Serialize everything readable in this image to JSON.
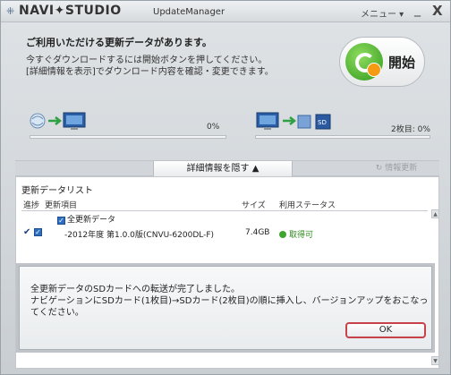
{
  "window": {
    "app_name": "NAVI✦STUDIO",
    "app_sub": "UpdateManager",
    "menu_label": "メニュー ▾",
    "minimize_glyph": "_",
    "close_glyph": "X"
  },
  "info": {
    "headline": "ご利用いただける更新データがあります。",
    "desc1": "今すぐダウンロードするには開始ボタンを押してください。",
    "desc2": "[詳細情報を表示]でダウンロード内容を確認・変更できます。",
    "start_label": "開始"
  },
  "progress": {
    "download_percent_text": "0%",
    "download_fraction": 0.0,
    "sd_text": "2枚目: 0%",
    "sd_fraction": 0.0
  },
  "detail": {
    "toggle_label": "詳細情報を隠す ▲",
    "refresh_label": "↻ 情報更新"
  },
  "list": {
    "title": "更新データリスト",
    "headers": [
      "進捗",
      "更新項目",
      "サイズ",
      "利用ステータス"
    ],
    "all_label": "全更新データ",
    "rows": [
      {
        "mark": "✔",
        "name": "-2012年度 第1.0.0版(CNVU-6200DL-F)",
        "size": "7.4GB",
        "status": "取得可"
      }
    ]
  },
  "dialog": {
    "line1": "全更新データのSDカードへの転送が完了しました。",
    "line2": "ナビゲーションにSDカード(1枚目)→SDカード(2枚目)の順に挿入し、バージョンアップをおこなっ",
    "line3": "てください。",
    "ok_label": "OK"
  },
  "colors": {
    "accent": "#3a78c6",
    "ok_border": "#c8424a",
    "status_green": "#3fa530"
  }
}
